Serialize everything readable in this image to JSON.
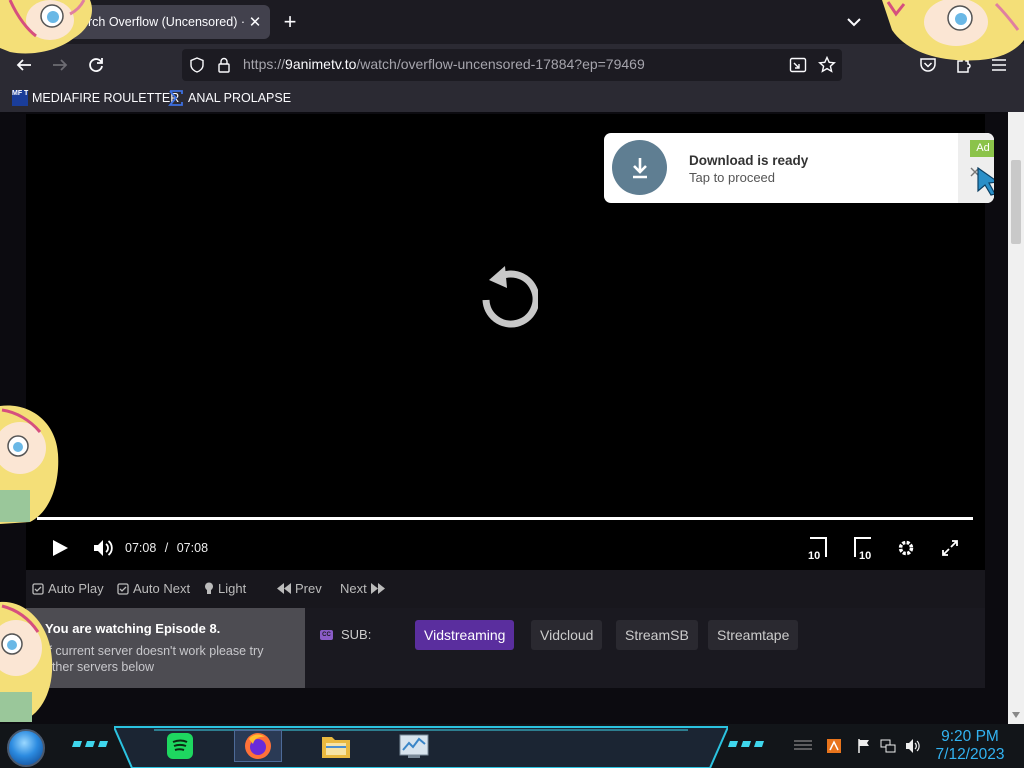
{
  "browser": {
    "tab": {
      "title": "rch Overflow (Uncensored) ·",
      "close_symbol": "✕"
    },
    "new_tab_symbol": "+",
    "url": {
      "host": "9animetv.to",
      "prefix": "https://",
      "path": "/watch/overflow-uncensored-17884?ep=79469"
    },
    "bookmarks": [
      {
        "label": "MEDIAFIRE ROULETTER",
        "icon": "mediafire-icon",
        "icon_text": "MF T"
      },
      {
        "label": "ANAL PROLAPSE",
        "icon": "sigma-icon"
      }
    ]
  },
  "player": {
    "current_time": "07:08",
    "time_separator": "/",
    "duration": "07:08",
    "progress": 1.0,
    "rewind_label": "10",
    "forward_label": "10"
  },
  "toolbar": {
    "auto_play": "Auto Play",
    "auto_next": "Auto Next",
    "light": "Light",
    "prev": "Prev",
    "next": "Next"
  },
  "episode": {
    "title": "You are watching Episode 8.",
    "note_line1": "If current server doesn't work please try",
    "note_line2": "other servers below"
  },
  "servers": {
    "cc_badge": "CC",
    "label": "SUB:",
    "items": [
      "Vidstreaming",
      "Vidcloud",
      "StreamSB",
      "Streamtape"
    ],
    "active": "Vidstreaming"
  },
  "ad": {
    "title": "Download is ready",
    "subtitle": "Tap to proceed",
    "badge": "Ad"
  },
  "taskbar": {
    "time": "9:20 PM",
    "date": "7/12/2023"
  },
  "colors": {
    "accent_purple": "#5a2e9e",
    "clock_blue": "#32b3f2",
    "ad_green": "#8bc34a"
  }
}
